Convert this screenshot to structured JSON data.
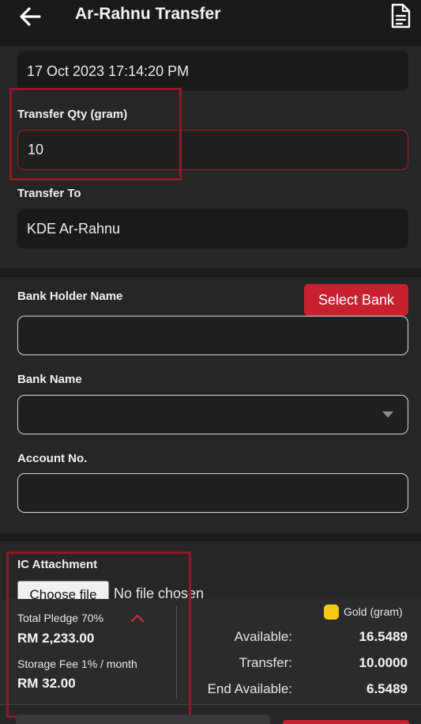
{
  "header": {
    "title": "Ar-Rahnu Transfer",
    "back_icon": "arrow-left-icon",
    "doc_icon": "document-icon"
  },
  "transfer": {
    "date_value": "17 Oct 2023 17:14:20 PM",
    "qty_label": "Transfer Qty (gram)",
    "qty_value": "10",
    "to_label": "Transfer To",
    "to_value": "KDE Ar-Rahnu"
  },
  "bank": {
    "holder_label": "Bank Holder Name",
    "select_bank_label": "Select Bank",
    "holder_value": "",
    "bankname_label": "Bank Name",
    "bankname_value": "",
    "account_label": "Account No.",
    "account_value": ""
  },
  "attachment": {
    "label": "IC Attachment",
    "choose_file_label": "Choose file",
    "no_file_text": "No file chosen"
  },
  "summary": {
    "pledge_label": "Total Pledge 70%",
    "pledge_value": "RM 2,233.00",
    "fee_label": "Storage Fee 1% / month",
    "fee_value": "RM 32.00",
    "gold_label": "Gold (gram)",
    "available_label": "Available:",
    "available_value": "16.5489",
    "transfer_label": "Transfer:",
    "transfer_value": "10.0000",
    "end_label": "End Available:",
    "end_value": "6.5489"
  },
  "colors": {
    "accent": "#c7202f",
    "highlight": "#8e1a27",
    "gold": "#f2cb12",
    "background": "#1c1c1c"
  }
}
